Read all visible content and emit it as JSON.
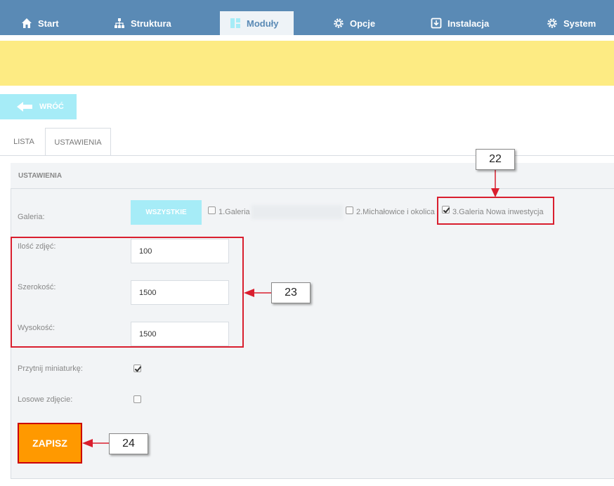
{
  "nav": {
    "items": [
      {
        "label": "Start",
        "icon": "home-icon"
      },
      {
        "label": "Struktura",
        "icon": "sitemap-icon"
      },
      {
        "label": "Moduły",
        "icon": "modules-icon"
      },
      {
        "label": "Opcje",
        "icon": "gear-icon"
      },
      {
        "label": "Instalacja",
        "icon": "install-icon"
      },
      {
        "label": "System",
        "icon": "gear-icon"
      }
    ],
    "active": "Moduły"
  },
  "back_label": "WRÓĆ",
  "tabs": [
    {
      "label": "LISTA"
    },
    {
      "label": "USTAWIENIA"
    }
  ],
  "settings": {
    "title": "USTAWIENIA",
    "gallery_label": "Galeria:",
    "all_button": "WSZYSTKIE",
    "galleries": [
      {
        "label": "1.Galeria",
        "checked": false
      },
      {
        "label": "2.Michałowice i okolica",
        "checked": false
      },
      {
        "label": "3.Galeria Nowa inwestycja",
        "checked": true
      }
    ],
    "count_label": "Ilość zdjęć:",
    "count_value": "100",
    "width_label": "Szerokość:",
    "width_value": "1500",
    "height_label": "Wysokość:",
    "height_value": "1500",
    "crop_label": "Przytnij miniaturkę:",
    "crop_checked": true,
    "random_label": "Losowe zdjęcie:",
    "random_checked": false,
    "save_label": "ZAPISZ"
  },
  "annotations": {
    "a22": "22",
    "a23": "23",
    "a24": "24"
  },
  "colors": {
    "nav_bg": "#5a8ab5",
    "notice_bg": "#fdeb83",
    "light_button": "#a6ecf7",
    "save_button": "#ff9900",
    "annotation_red": "#d91e2e"
  }
}
